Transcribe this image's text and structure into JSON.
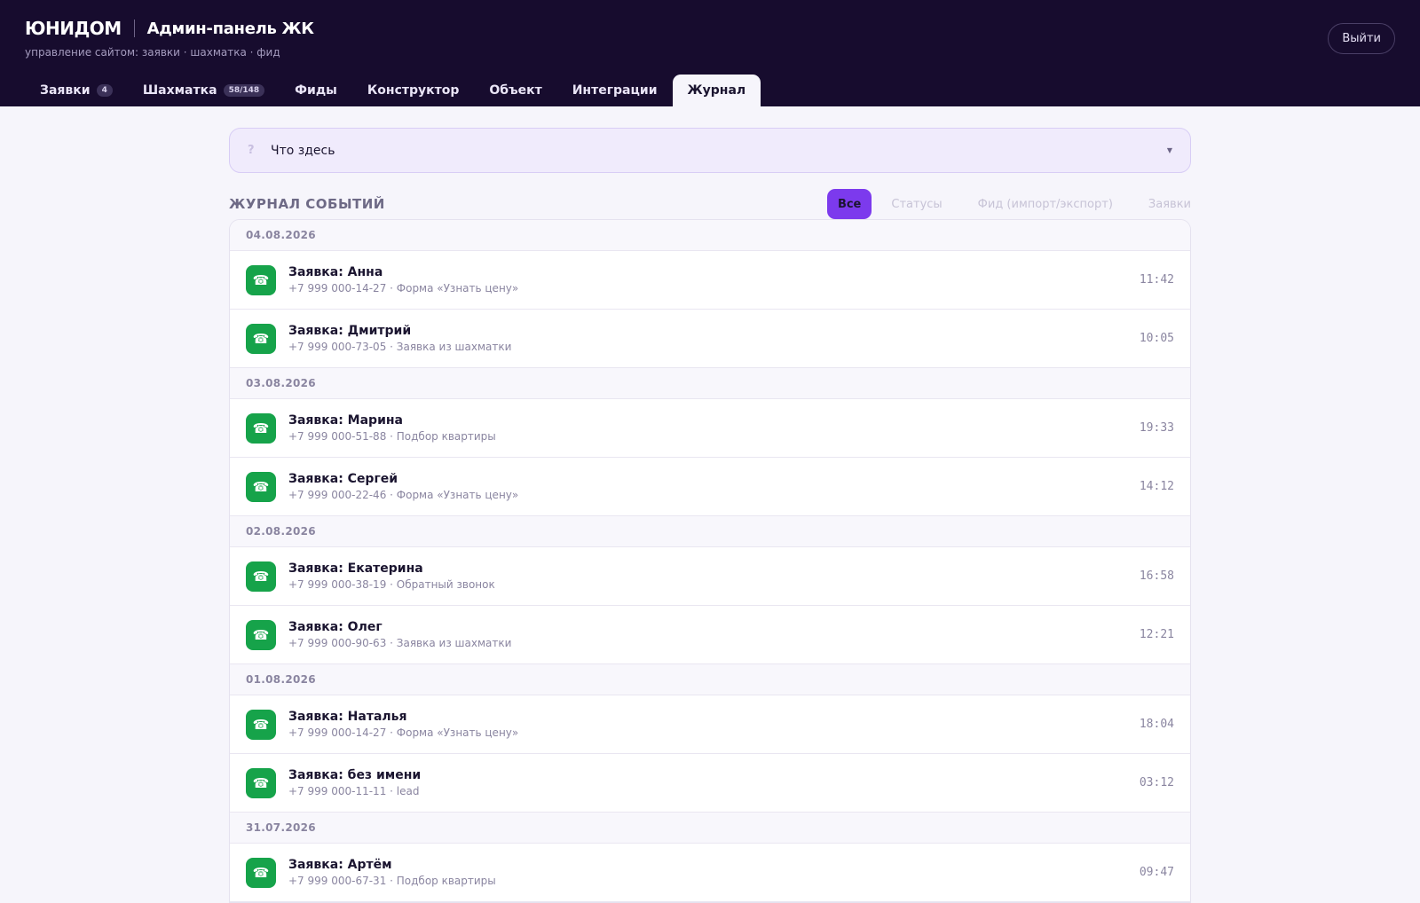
{
  "header": {
    "brand": "ЮНИДОМ",
    "panel_title": "Админ-панель ЖК",
    "subtitle": "управление сайтом: заявки · шахматка · фид",
    "logout_label": "Выйти"
  },
  "tabs": [
    {
      "label": "Заявки",
      "badge": "4"
    },
    {
      "label": "Шахматка",
      "badge": "58/148"
    },
    {
      "label": "Фиды"
    },
    {
      "label": "Конструктор"
    },
    {
      "label": "Объект"
    },
    {
      "label": "Интеграции"
    },
    {
      "label": "Журнал",
      "active": true
    }
  ],
  "help": {
    "icon": "question-icon",
    "label": "Что здесь"
  },
  "journal": {
    "title": "ЖУРНАЛ СОБЫТИЙ",
    "filters": [
      {
        "label": "Все",
        "active": true
      },
      {
        "label": "Статусы"
      },
      {
        "label": "Фид (импорт/экспорт)"
      },
      {
        "label": "Заявки"
      }
    ],
    "groups": [
      {
        "date": "04.08.2026",
        "events": [
          {
            "title": "Заявка: Анна",
            "sub": "+7 999 000-14-27 · Форма «Узнать цену»",
            "time": "11:42"
          },
          {
            "title": "Заявка: Дмитрий",
            "sub": "+7 999 000-73-05 · Заявка из шахматки",
            "time": "10:05"
          }
        ]
      },
      {
        "date": "03.08.2026",
        "events": [
          {
            "title": "Заявка: Марина",
            "sub": "+7 999 000-51-88 · Подбор квартиры",
            "time": "19:33"
          },
          {
            "title": "Заявка: Сергей",
            "sub": "+7 999 000-22-46 · Форма «Узнать цену»",
            "time": "14:12"
          }
        ]
      },
      {
        "date": "02.08.2026",
        "events": [
          {
            "title": "Заявка: Екатерина",
            "sub": "+7 999 000-38-19 · Обратный звонок",
            "time": "16:58"
          },
          {
            "title": "Заявка: Олег",
            "sub": "+7 999 000-90-63 · Заявка из шахматки",
            "time": "12:21"
          }
        ]
      },
      {
        "date": "01.08.2026",
        "events": [
          {
            "title": "Заявка: Наталья",
            "sub": "+7 999 000-14-27 · Форма «Узнать цену»",
            "time": "18:04"
          },
          {
            "title": "Заявка: без имени",
            "sub": "+7 999 000-11-11 · lead",
            "time": "03:12"
          }
        ]
      },
      {
        "date": "31.07.2026",
        "events": [
          {
            "title": "Заявка: Артём",
            "sub": "+7 999 000-67-31 · Подбор квартиры",
            "time": "09:47"
          }
        ]
      }
    ],
    "event_icon": "phone-icon"
  },
  "colors": {
    "header_bg": "#170c2e",
    "accent": "#7c3aed",
    "event_icon_bg": "#16a34a"
  }
}
